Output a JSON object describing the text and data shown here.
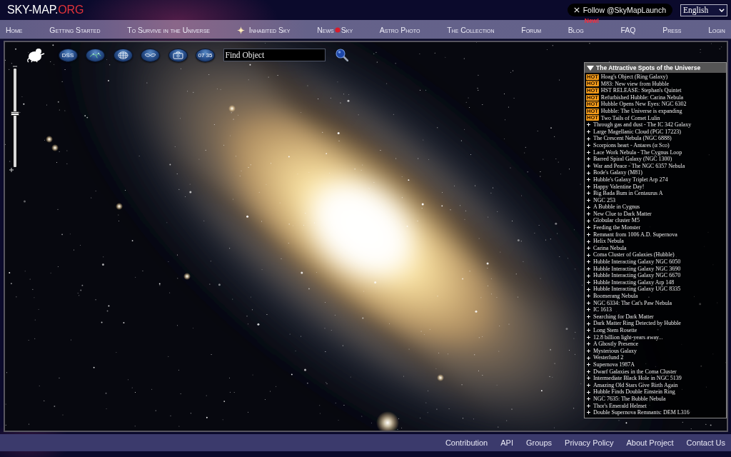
{
  "header": {
    "logo": {
      "text": "SKY-MAP.",
      "accent": "ORG"
    },
    "follow_button": "Follow @SkyMapLaunch",
    "language": "English"
  },
  "nav": [
    {
      "kind": "plain",
      "label": "Home"
    },
    {
      "kind": "plain",
      "label": "Getting Started"
    },
    {
      "kind": "plain",
      "label": "To Survive in the Universe"
    },
    {
      "kind": "star",
      "label": "Inhabited Sky"
    },
    {
      "kind": "split",
      "label": "News",
      "label_after": "Sky"
    },
    {
      "kind": "plain",
      "label": "Astro Photo"
    },
    {
      "kind": "plain",
      "label": "The Collection"
    },
    {
      "kind": "plain",
      "label": "Forum"
    },
    {
      "kind": "badge",
      "label": "Blog",
      "badge": "New!"
    },
    {
      "kind": "plain",
      "label": "FAQ"
    },
    {
      "kind": "plain",
      "label": "Press"
    },
    {
      "kind": "plain",
      "label": "Login"
    }
  ],
  "map": {
    "toolbar": {
      "survey_button": "DSS",
      "time_button": "07 35",
      "search": {
        "placeholder": "Find Object"
      }
    },
    "zoom_slider": {
      "level": 0.54
    },
    "panel": {
      "title": "The Attractive Spots of the Universe",
      "expanded": true,
      "items": [
        {
          "kind": "hot",
          "badge": "HOT",
          "title": "Hoag's Object (Ring Galaxy)"
        },
        {
          "kind": "hot",
          "badge": "HOT",
          "title": "M83: New view from Hubble"
        },
        {
          "kind": "hot",
          "badge": "HOT",
          "title": "HST RELEASE: Stephan's Quintet"
        },
        {
          "kind": "hot",
          "badge": "HOT",
          "title": "Refurbished Hubble: Carina Nebula"
        },
        {
          "kind": "hot",
          "badge": "HOT",
          "title": "Hubble Opens New Eyes: NGC 6302"
        },
        {
          "kind": "hot",
          "badge": "HOT",
          "title": "Hubble: The Universe is expanding"
        },
        {
          "kind": "hot",
          "badge": "HOT",
          "title": "Two Tails of Comet Lulin"
        },
        {
          "kind": "plus",
          "title": "Through gas and dust - The IC 342 Galaxy"
        },
        {
          "kind": "plus",
          "title": "Large Magellanic Cloud (PGC 17223)"
        },
        {
          "kind": "plus",
          "title": "The Crescent Nebula (NGC 6888)"
        },
        {
          "kind": "plus",
          "title": "Scorpions heart - Antares (α Sco)"
        },
        {
          "kind": "plus",
          "title": "Lace Work Nebula - The Cygnus Loop"
        },
        {
          "kind": "plus",
          "title": "Barred Spiral Galaxy (NGC 1300)"
        },
        {
          "kind": "plus",
          "title": "War and Peace - The NGC 6357 Nebula"
        },
        {
          "kind": "plus",
          "title": "Bode's Galaxy (M81)"
        },
        {
          "kind": "plus",
          "title": "Hubble's Galaxy Triplet Arp 274"
        },
        {
          "kind": "plus",
          "title": "Happy Valentine Day!"
        },
        {
          "kind": "plus",
          "title": "Big Bada Bum in Centaurus A"
        },
        {
          "kind": "plus",
          "title": "NGC 253"
        },
        {
          "kind": "plus",
          "title": "A Bubble in Cygnus"
        },
        {
          "kind": "plus",
          "title": "New Clue to Dark Matter"
        },
        {
          "kind": "plus",
          "title": "Globular cluster M5"
        },
        {
          "kind": "plus",
          "title": "Feeding the Monster"
        },
        {
          "kind": "plus",
          "title": "Remnant from 1006 A.D. Supernova"
        },
        {
          "kind": "plus",
          "title": "Helix Nebula"
        },
        {
          "kind": "plus",
          "title": "Carina Nebula"
        },
        {
          "kind": "plus",
          "title": "Coma Cluster of Galaxies (Hubble)"
        },
        {
          "kind": "plus",
          "title": "Hubble Interacting Galaxy NGC 6050"
        },
        {
          "kind": "plus",
          "title": "Hubble Interacting Galaxy NGC 3690"
        },
        {
          "kind": "plus",
          "title": "Hubble Interacting Galaxy NGC 6670"
        },
        {
          "kind": "plus",
          "title": "Hubble Interacting Galaxy Arp 148"
        },
        {
          "kind": "plus",
          "title": "Hubble Interacting Galaxy UGC 8335"
        },
        {
          "kind": "plus",
          "title": "Boomerang Nebula"
        },
        {
          "kind": "plus",
          "title": "NGC 6334: The Cat's Paw Nebula"
        },
        {
          "kind": "plus",
          "title": "IC 1613"
        },
        {
          "kind": "plus",
          "title": "Searching for Dark Matter"
        },
        {
          "kind": "plus",
          "title": "Dark Matter Ring Detected by Hubble"
        },
        {
          "kind": "plus",
          "title": "Long Stem Rosette"
        },
        {
          "kind": "plus",
          "title": "12.8 billion light-years away..."
        },
        {
          "kind": "plus",
          "title": "A Ghostly Presence"
        },
        {
          "kind": "plus",
          "title": "Mysterious Galaxy"
        },
        {
          "kind": "plus",
          "title": "Westerlund 2"
        },
        {
          "kind": "plus",
          "title": "Supernova 1987A"
        },
        {
          "kind": "plus",
          "title": "Dwarf Galaxies in the Coma Cluster"
        },
        {
          "kind": "plus",
          "title": "Intermediate Black Hole in NGC 5139"
        },
        {
          "kind": "plus",
          "title": "Amazing Old Stars Give Birth Again"
        },
        {
          "kind": "plus",
          "title": "Hubble Finds Double Einstein Ring"
        },
        {
          "kind": "plus",
          "title": "NGC 7635: The Bubble Nebula"
        },
        {
          "kind": "plus",
          "title": "Thor's Emerald Helmet"
        },
        {
          "kind": "plus",
          "title": "Double Supernova Remnants: DEM L316"
        }
      ]
    }
  },
  "footer": {
    "links": [
      "Contribution",
      "API",
      "Groups",
      "Privacy Policy",
      "About Project",
      "Contact Us"
    ]
  }
}
